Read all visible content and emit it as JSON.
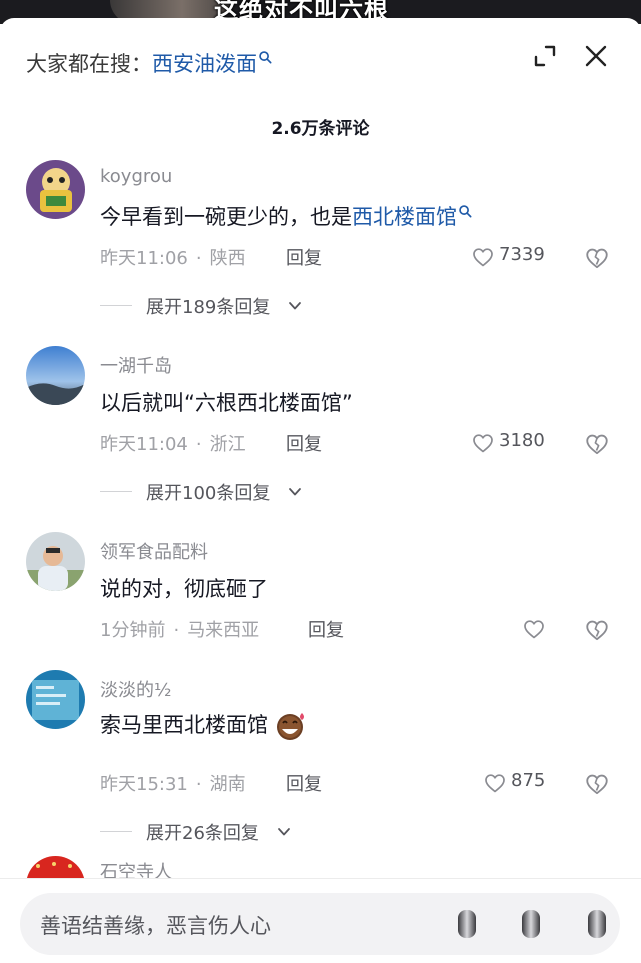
{
  "video": {
    "caption": "这绝对不叫六根"
  },
  "header": {
    "search_prefix": "大家都在搜：",
    "search_keyword": "西安油泼面",
    "expand_icon": "expand-icon",
    "close_icon": "close-icon"
  },
  "comment_count": "2.6万条评论",
  "comments": [
    {
      "username": "koygrou",
      "text_plain": "今早看到一碗更少的，也是",
      "text_link": "西北楼面馆",
      "time": "昨天11:06",
      "location": "陕西",
      "reply": "回复",
      "likes": "7339",
      "expand": "展开189条回复"
    },
    {
      "username": "一湖千岛",
      "text": "以后就叫“六根西北楼面馆”",
      "time": "昨天11:04",
      "location": "浙江",
      "reply": "回复",
      "likes": "3180",
      "expand": "展开100条回复"
    },
    {
      "username": "领军食品配料",
      "text": "说的对，彻底砸了",
      "time": "1分钟前",
      "location": "马来西亚",
      "reply": "回复",
      "likes": ""
    },
    {
      "username": "淡淡的½",
      "text": "索马里西北楼面馆",
      "emoji": "laughing-sweat-emoji",
      "time": "昨天15:31",
      "location": "湖南",
      "reply": "回复",
      "likes": "875",
      "expand": "展开26条回复"
    },
    {
      "username": "石空寺人"
    }
  ],
  "input": {
    "placeholder": "善语结善缘，恶言伤人心"
  },
  "colors": {
    "link": "#1f5aa8",
    "text": "#161823",
    "meta": "#a0a1a6"
  }
}
